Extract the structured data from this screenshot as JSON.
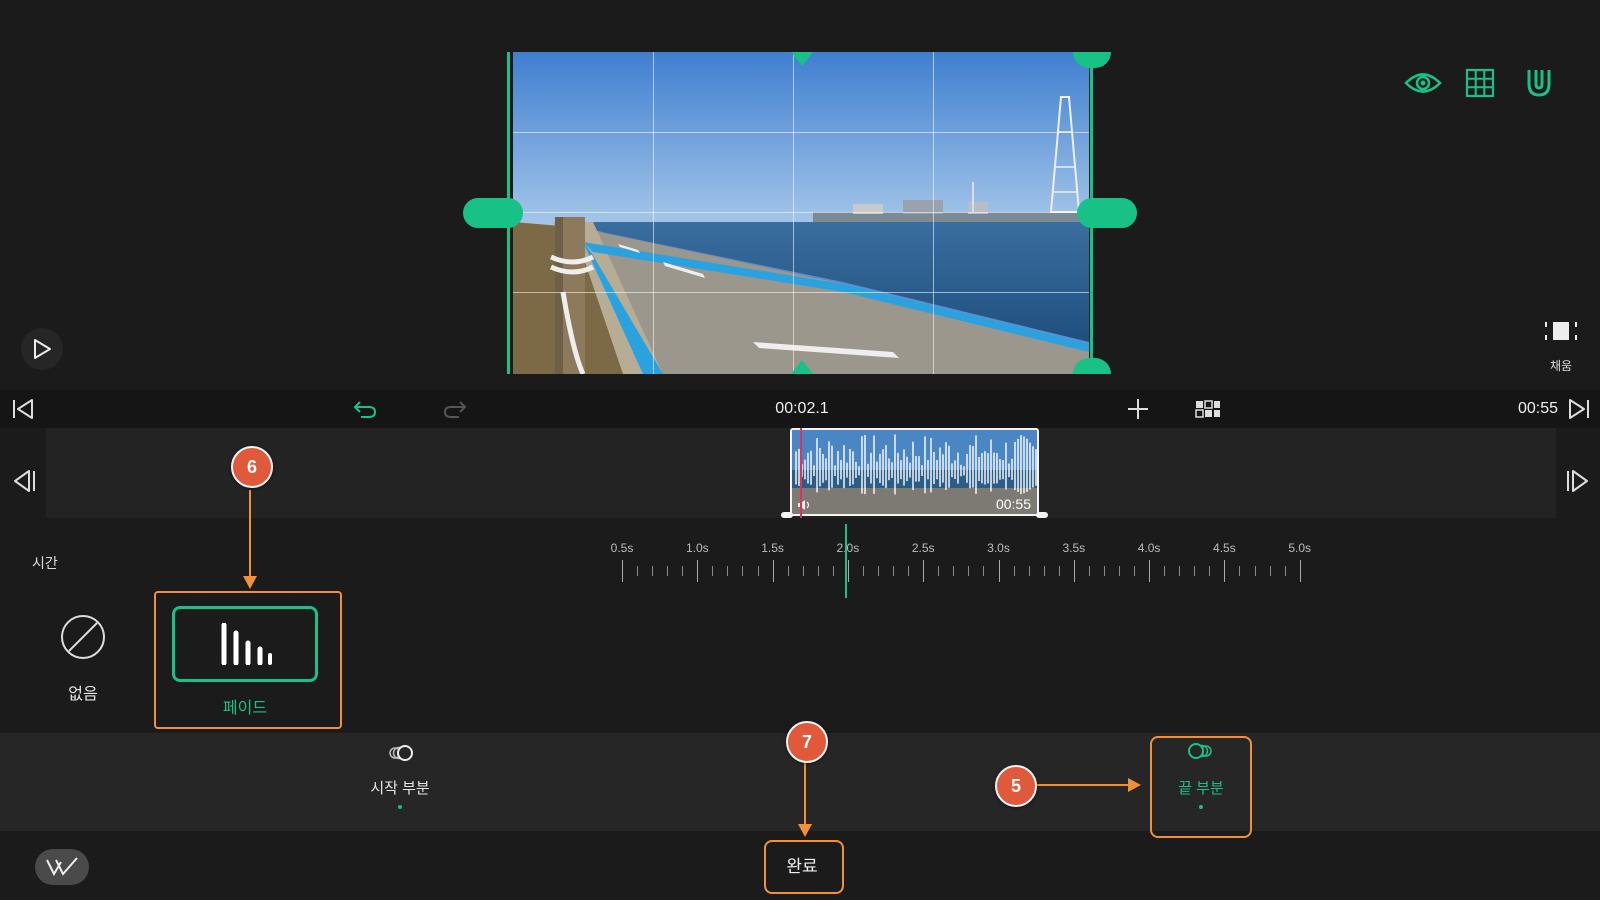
{
  "preview": {
    "fill_label": "채움"
  },
  "toolbar": {
    "current_time": "00:02.1",
    "total_time": "00:55"
  },
  "clip": {
    "duration": "00:55"
  },
  "ruler": {
    "section_label": "시간",
    "labels": [
      "0.5s",
      "1.0s",
      "1.5s",
      "2.0s",
      "2.5s",
      "3.0s",
      "3.5s",
      "4.0s",
      "4.5s",
      "5.0s"
    ],
    "playhead_value_s": 2.0
  },
  "transitions": {
    "none_label": "없음",
    "fade_label": "페이드",
    "selected": "fade"
  },
  "tabs": {
    "start_label": "시작 부분",
    "end_label": "끝 부분",
    "active": "end"
  },
  "footer": {
    "done_label": "완료"
  },
  "callouts": {
    "c5": "5",
    "c6": "6",
    "c7": "7"
  },
  "colors": {
    "accent": "#18c186",
    "callout": "#e0593a",
    "highlight_box": "#f0913a",
    "playhead_red": "#e0315a"
  },
  "icons": {
    "eye": "eye-icon",
    "grid": "grid-icon",
    "magnet": "magnet-icon",
    "play": "play-icon",
    "fill": "fill-icon",
    "skip_start": "skip-start-icon",
    "skip_end": "skip-end-icon",
    "undo": "undo-icon",
    "redo": "redo-icon",
    "add": "plus-icon",
    "layout": "layout-icon",
    "prev_frame": "prev-frame-icon",
    "next_frame": "next-frame-icon",
    "none": "none-icon",
    "fade": "fade-icon",
    "start": "start-transition-icon",
    "end": "end-transition-icon",
    "logo": "app-logo-icon"
  }
}
